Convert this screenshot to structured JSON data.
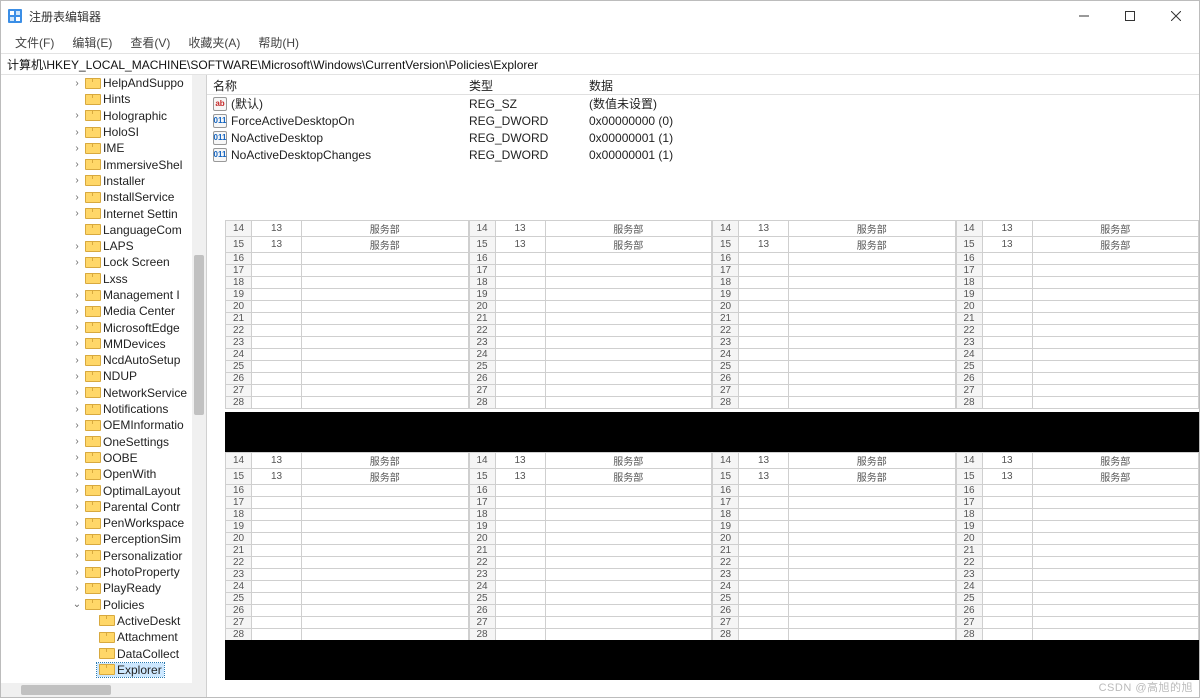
{
  "window": {
    "title": "注册表编辑器"
  },
  "menu": {
    "file": "文件(F)",
    "edit": "编辑(E)",
    "view": "查看(V)",
    "favorites": "收藏夹(A)",
    "help": "帮助(H)"
  },
  "address": "计算机\\HKEY_LOCAL_MACHINE\\SOFTWARE\\Microsoft\\Windows\\CurrentVersion\\Policies\\Explorer",
  "columns": {
    "name": "名称",
    "type": "类型",
    "data": "数据"
  },
  "values": [
    {
      "icon": "str",
      "name": "(默认)",
      "type": "REG_SZ",
      "data": "(数值未设置)"
    },
    {
      "icon": "bin",
      "name": "ForceActiveDesktopOn",
      "type": "REG_DWORD",
      "data": "0x00000000 (0)"
    },
    {
      "icon": "bin",
      "name": "NoActiveDesktop",
      "type": "REG_DWORD",
      "data": "0x00000001 (1)"
    },
    {
      "icon": "bin",
      "name": "NoActiveDesktopChanges",
      "type": "REG_DWORD",
      "data": "0x00000001 (1)"
    }
  ],
  "tree": [
    {
      "depth": 5,
      "label": "HelpAndSuppo",
      "expandable": true
    },
    {
      "depth": 5,
      "label": "Hints"
    },
    {
      "depth": 5,
      "label": "Holographic",
      "expandable": true
    },
    {
      "depth": 5,
      "label": "HoloSI",
      "expandable": true
    },
    {
      "depth": 5,
      "label": "IME",
      "expandable": true
    },
    {
      "depth": 5,
      "label": "ImmersiveShel",
      "expandable": true
    },
    {
      "depth": 5,
      "label": "Installer",
      "expandable": true
    },
    {
      "depth": 5,
      "label": "InstallService",
      "expandable": true
    },
    {
      "depth": 5,
      "label": "Internet Settin",
      "expandable": true
    },
    {
      "depth": 5,
      "label": "LanguageCom"
    },
    {
      "depth": 5,
      "label": "LAPS",
      "expandable": true
    },
    {
      "depth": 5,
      "label": "Lock Screen",
      "expandable": true
    },
    {
      "depth": 5,
      "label": "Lxss"
    },
    {
      "depth": 5,
      "label": "Management I",
      "expandable": true
    },
    {
      "depth": 5,
      "label": "Media Center",
      "expandable": true
    },
    {
      "depth": 5,
      "label": "MicrosoftEdge",
      "expandable": true
    },
    {
      "depth": 5,
      "label": "MMDevices",
      "expandable": true
    },
    {
      "depth": 5,
      "label": "NcdAutoSetup",
      "expandable": true
    },
    {
      "depth": 5,
      "label": "NDUP",
      "expandable": true
    },
    {
      "depth": 5,
      "label": "NetworkService",
      "expandable": true
    },
    {
      "depth": 5,
      "label": "Notifications",
      "expandable": true
    },
    {
      "depth": 5,
      "label": "OEMInformatio",
      "expandable": true
    },
    {
      "depth": 5,
      "label": "OneSettings",
      "expandable": true
    },
    {
      "depth": 5,
      "label": "OOBE",
      "expandable": true
    },
    {
      "depth": 5,
      "label": "OpenWith",
      "expandable": true
    },
    {
      "depth": 5,
      "label": "OptimalLayout",
      "expandable": true
    },
    {
      "depth": 5,
      "label": "Parental Contr",
      "expandable": true
    },
    {
      "depth": 5,
      "label": "PenWorkspace",
      "expandable": true
    },
    {
      "depth": 5,
      "label": "PerceptionSim",
      "expandable": true
    },
    {
      "depth": 5,
      "label": "Personalizatior",
      "expandable": true
    },
    {
      "depth": 5,
      "label": "PhotoProperty",
      "expandable": true
    },
    {
      "depth": 5,
      "label": "PlayReady",
      "expandable": true
    },
    {
      "depth": 5,
      "label": "Policies",
      "expandable": true,
      "expanded": true
    },
    {
      "depth": 6,
      "label": "ActiveDeskt"
    },
    {
      "depth": 6,
      "label": "Attachment"
    },
    {
      "depth": 6,
      "label": "DataCollect"
    },
    {
      "depth": 6,
      "label": "Explorer",
      "selected": true
    }
  ],
  "mini": {
    "rows_top": [
      "14",
      "15",
      "16",
      "17",
      "18",
      "19",
      "20",
      "21",
      "22",
      "23",
      "24",
      "25",
      "26",
      "27",
      "28"
    ],
    "cell_num": "13",
    "cell_text": "服务部"
  },
  "watermark": "CSDN @高旭的旭"
}
